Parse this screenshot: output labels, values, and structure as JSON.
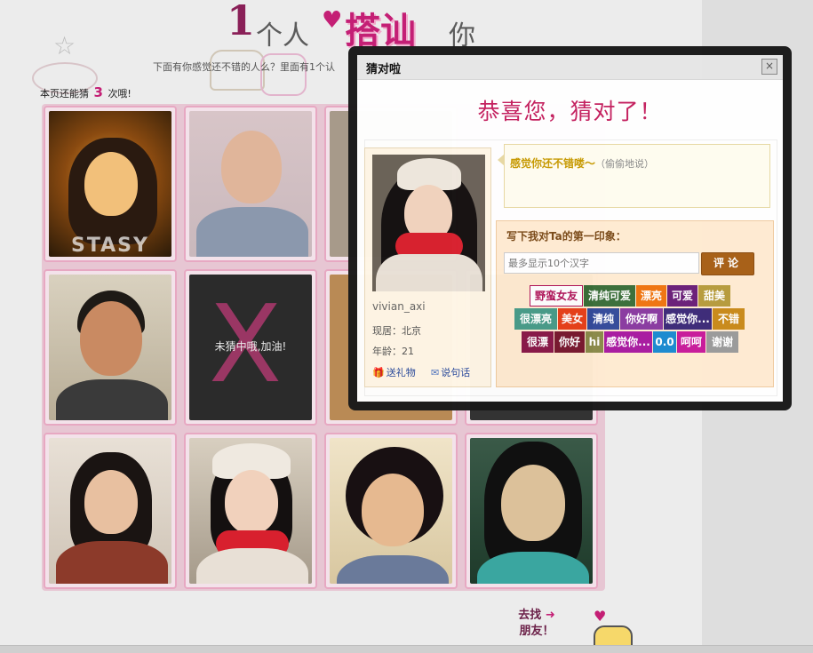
{
  "page": {
    "title_num": "1",
    "title_w1": "个人",
    "title_w2": "搭讪",
    "title_w3": "你",
    "subtitle": "下面有你感觉还不错的人么？里面有1个认",
    "remaining_prefix": "本页还能猜",
    "remaining_count": "3",
    "remaining_suffix": "次哦!",
    "tiles": [
      {
        "kind": "photo",
        "overlay": "STASY"
      },
      {
        "kind": "photo"
      },
      {
        "kind": "photo"
      },
      {
        "kind": "photo"
      },
      {
        "kind": "missed",
        "text": "未猜中哦,加油!"
      },
      {
        "kind": "photo"
      },
      {
        "kind": "photo"
      },
      {
        "kind": "photo"
      },
      {
        "kind": "photo"
      },
      {
        "kind": "photo"
      },
      {
        "kind": "photo"
      }
    ],
    "goto_line1": "去找",
    "goto_line2": "朋友！"
  },
  "dialog": {
    "title": "猜对啦",
    "close_icon": "×",
    "heading": "恭喜您，猜对了！",
    "profile": {
      "username": "vivian_axi",
      "location": "现居：北京",
      "age": "年龄：21",
      "gift": "送礼物",
      "message": "说句话"
    },
    "bubble_text": "感觉你还不错喽～",
    "bubble_sub": "（偷偷地说）",
    "impression_label": "写下我对Ta的第一印象：",
    "input_placeholder": "最多显示10个汉字",
    "comment_button": "评论",
    "tags": [
      {
        "label": "野蛮女友",
        "color": "#ffffff",
        "text": "#b1155a"
      },
      {
        "label": "清纯可爱",
        "color": "#3a6e39"
      },
      {
        "label": "漂亮",
        "color": "#f0740f"
      },
      {
        "label": "可爱",
        "color": "#6a1e78"
      },
      {
        "label": "甜美",
        "color": "#b79b3c"
      },
      {
        "label": "很漂亮",
        "color": "#4a9d8a"
      },
      {
        "label": "美女",
        "color": "#e8411a"
      },
      {
        "label": "清纯",
        "color": "#334a9a"
      },
      {
        "label": "你好啊",
        "color": "#8a3aa0"
      },
      {
        "label": "感觉你...",
        "color": "#3c2a78"
      },
      {
        "label": "不错",
        "color": "#c98a1a"
      },
      {
        "label": "很漂",
        "color": "#8a1a4a"
      },
      {
        "label": "你好",
        "color": "#7a1a30"
      },
      {
        "label": "hi",
        "color": "#8a8a4a"
      },
      {
        "label": "感觉你...",
        "color": "#a81aa0"
      },
      {
        "label": "0.0",
        "color": "#1a8ad0"
      },
      {
        "label": "呵呵",
        "color": "#c81a9a"
      },
      {
        "label": "谢谢",
        "color": "#9a9a9a"
      }
    ]
  }
}
